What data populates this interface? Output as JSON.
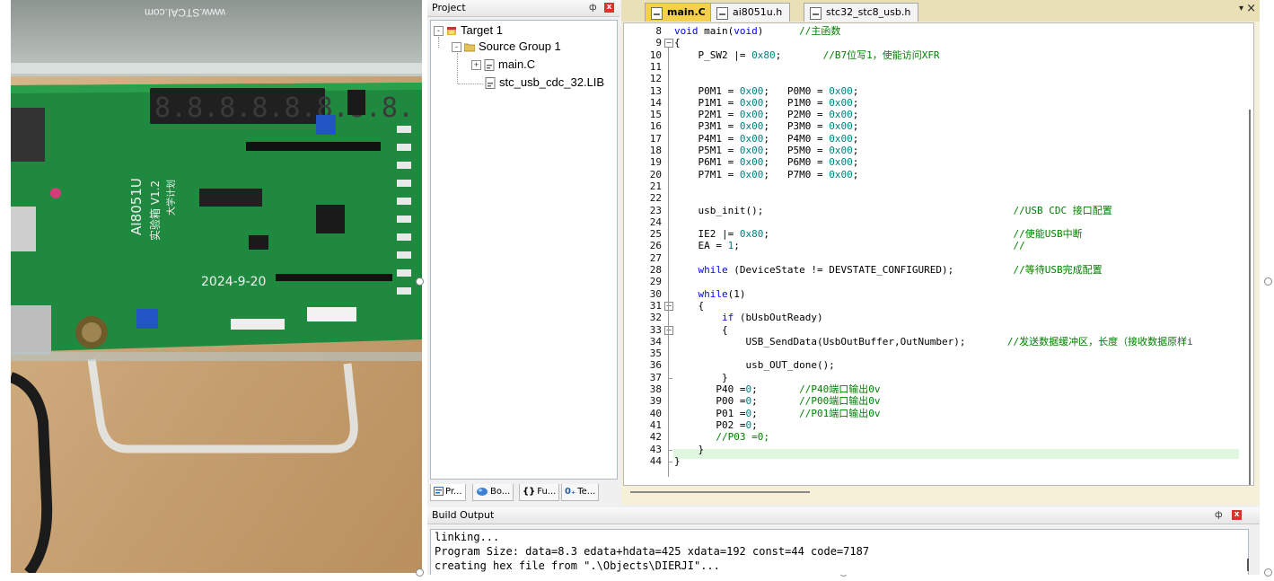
{
  "photo": {
    "watermark": "www.STCAI.com",
    "board_title": "AI8051U",
    "board_subtitle": "实验箱 V1.2",
    "board_subtitle2": "大学计划",
    "date_mark": "2024-9-20",
    "display_digits": "8.8.8.8.8.8.8.8."
  },
  "project": {
    "title": "Project",
    "pin": "ф",
    "close": "x",
    "tree": [
      {
        "label": "Target 1",
        "expander": "-",
        "icon": "target-icon"
      },
      {
        "label": "Source Group 1",
        "expander": "-",
        "icon": "folder-icon"
      },
      {
        "label": "main.C",
        "expander": "+",
        "icon": "c-file-icon"
      },
      {
        "label": "stc_usb_cdc_32.LIB",
        "expander": "",
        "icon": "lib-file-icon"
      }
    ],
    "tabs": [
      {
        "label": "Pr...",
        "icon": "project-tab-icon"
      },
      {
        "label": "Bo...",
        "icon": "books-tab-icon"
      },
      {
        "label": "Fu...",
        "icon": "functions-tab-icon"
      },
      {
        "label": "Te...",
        "icon": "templates-tab-icon"
      }
    ],
    "tab_glyphs": [
      "{}",
      "0₊"
    ]
  },
  "editor": {
    "tabs": [
      {
        "label": "main.C",
        "active": true
      },
      {
        "label": "ai8051u.h",
        "active": false
      },
      {
        "label": "stc32_stc8_usb.h",
        "active": false
      }
    ],
    "menu_glyph": "▾",
    "close_glyph": "×",
    "lines": [
      {
        "n": "8",
        "html": "<span class=\"kw\">void</span> main(<span class=\"kw\">void</span>)      <span class=\"cm\">//主函数</span>"
      },
      {
        "n": "9",
        "html": "{"
      },
      {
        "n": "10",
        "html": "    P_SW2 |= <span class=\"num\">0x80</span>;       <span class=\"cm\">//B7位写1，使能访问XFR</span>"
      },
      {
        "n": "11",
        "html": ""
      },
      {
        "n": "12",
        "html": ""
      },
      {
        "n": "13",
        "html": "    P0M1 = <span class=\"num\">0x00</span>;   P0M0 = <span class=\"num\">0x00</span>;"
      },
      {
        "n": "14",
        "html": "    P1M1 = <span class=\"num\">0x00</span>;   P1M0 = <span class=\"num\">0x00</span>;"
      },
      {
        "n": "15",
        "html": "    P2M1 = <span class=\"num\">0x00</span>;   P2M0 = <span class=\"num\">0x00</span>;"
      },
      {
        "n": "16",
        "html": "    P3M1 = <span class=\"num\">0x00</span>;   P3M0 = <span class=\"num\">0x00</span>;"
      },
      {
        "n": "17",
        "html": "    P4M1 = <span class=\"num\">0x00</span>;   P4M0 = <span class=\"num\">0x00</span>;"
      },
      {
        "n": "18",
        "html": "    P5M1 = <span class=\"num\">0x00</span>;   P5M0 = <span class=\"num\">0x00</span>;"
      },
      {
        "n": "19",
        "html": "    P6M1 = <span class=\"num\">0x00</span>;   P6M0 = <span class=\"num\">0x00</span>;"
      },
      {
        "n": "20",
        "html": "    P7M1 = <span class=\"num\">0x00</span>;   P7M0 = <span class=\"num\">0x00</span>;"
      },
      {
        "n": "21",
        "html": ""
      },
      {
        "n": "22",
        "html": ""
      },
      {
        "n": "23",
        "html": "    usb_init();                                          <span class=\"cm\">//USB CDC 接口配置</span>"
      },
      {
        "n": "24",
        "html": ""
      },
      {
        "n": "25",
        "html": "    IE2 |= <span class=\"num\">0x80</span>;                                         <span class=\"cm\">//使能USB中断</span>"
      },
      {
        "n": "26",
        "html": "    EA = <span class=\"num\">1</span>;                                              <span class=\"cm\">//</span>"
      },
      {
        "n": "27",
        "html": ""
      },
      {
        "n": "28",
        "html": "    <span class=\"kw\">while</span> (DeviceState != DEVSTATE_CONFIGURED);          <span class=\"cm\">//等待USB完成配置</span>"
      },
      {
        "n": "29",
        "html": ""
      },
      {
        "n": "30",
        "html": "    <span class=\"kw\">while</span>(1)"
      },
      {
        "n": "31",
        "html": "    {"
      },
      {
        "n": "32",
        "html": "        <span class=\"kw\">if</span> (bUsbOutReady)"
      },
      {
        "n": "33",
        "html": "        {"
      },
      {
        "n": "34",
        "html": "            USB_SendData(UsbOutBuffer,OutNumber);       <span class=\"cm\">//发送数据缓冲区，长度（接收数据原样i</span>"
      },
      {
        "n": "35",
        "html": ""
      },
      {
        "n": "36",
        "html": "            usb_OUT_done();"
      },
      {
        "n": "37",
        "html": "        }"
      },
      {
        "n": "38",
        "html": "       P40 =<span class=\"num\">0</span>;       <span class=\"cm\">//P40端口输出0v</span>"
      },
      {
        "n": "39",
        "html": "       P00 =<span class=\"num\">0</span>;       <span class=\"cm\">//P00端口输出0v</span>"
      },
      {
        "n": "40",
        "html": "       P01 =<span class=\"num\">0</span>;       <span class=\"cm\">//P01端口输出0v</span>"
      },
      {
        "n": "41",
        "html": "       P02 =<span class=\"num\">0</span>;"
      },
      {
        "n": "42",
        "html": "       <span class=\"cm\">//P03 =0;</span>"
      },
      {
        "n": "43",
        "html": "    }"
      },
      {
        "n": "44",
        "html": "}"
      }
    ]
  },
  "build": {
    "title": "Build Output",
    "pin": "ф",
    "close": "x",
    "lines": [
      "linking...",
      "Program Size: data=8.3 edata+hdata=425 xdata=192 const=44 code=7187",
      "creating hex file from \".\\Objects\\DIERJI\"..."
    ]
  }
}
